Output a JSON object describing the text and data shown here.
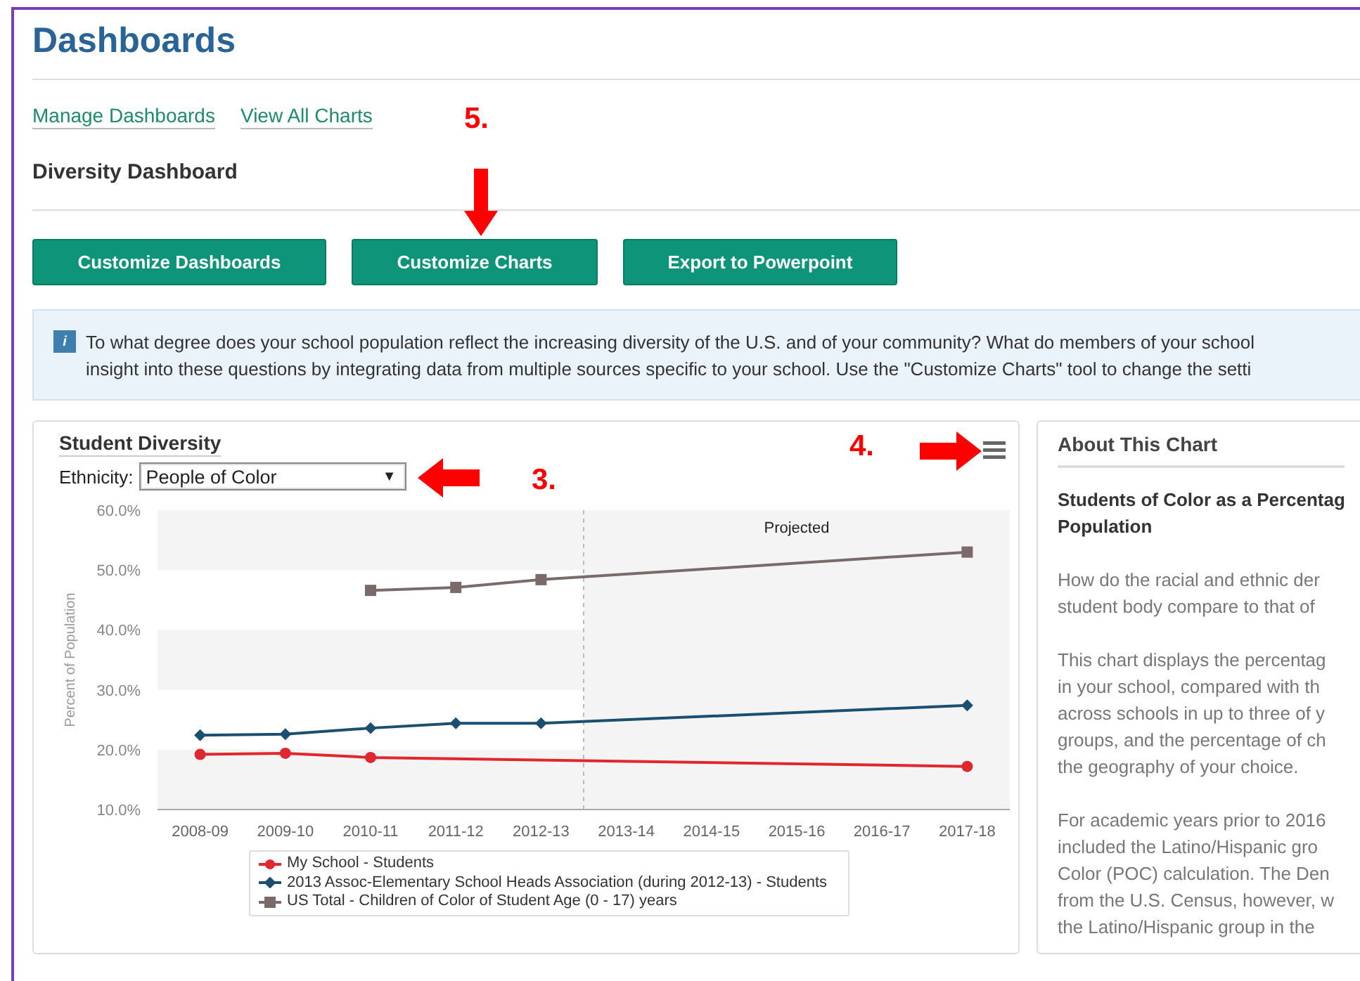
{
  "page_title": "Dashboards",
  "links": [
    "Manage Dashboards",
    "View All Charts"
  ],
  "dashboard_title": "Diversity Dashboard",
  "buttons": [
    "Customize Dashboards",
    "Customize Charts",
    "Export to Powerpoint"
  ],
  "info": {
    "icon": "i",
    "lines": [
      "To what degree does your school population reflect the increasing diversity of the U.S. and of your community? What do members of your school",
      "insight into these questions by integrating data from multiple sources specific to your school. Use the \"Customize Charts\" tool to change the setti"
    ]
  },
  "chart_card": {
    "title": "Student Diversity",
    "filter_label": "Ethnicity:",
    "filter_value": "People of Color",
    "filter_caret": "▼",
    "chart_data": {
      "type": "line",
      "ylabel": "Percent of Population",
      "categories": [
        "2008-09",
        "2009-10",
        "2010-11",
        "2011-12",
        "2012-13",
        "2013-14",
        "2014-15",
        "2015-16",
        "2016-17",
        "2017-18"
      ],
      "ylim": [
        10,
        60
      ],
      "yticks": [
        {
          "value": 10,
          "label": "10.0%"
        },
        {
          "value": 20,
          "label": "20.0%"
        },
        {
          "value": 30,
          "label": "30.0%"
        },
        {
          "value": 40,
          "label": "40.0%"
        },
        {
          "value": 50,
          "label": "50.0%"
        },
        {
          "value": 60,
          "label": "60.0%"
        }
      ],
      "annotations": [
        "Projected"
      ],
      "bands": [
        {
          "axis": "y",
          "from": 10,
          "to": 20
        },
        {
          "axis": "y",
          "from": 30,
          "to": 40
        },
        {
          "axis": "y",
          "from": 50,
          "to": 60
        },
        {
          "axis": "x",
          "from": "2013-14",
          "to": "2017-18"
        }
      ],
      "series": [
        {
          "name": "My School - Students",
          "color": "#e0262f",
          "marker": "circle",
          "values": [
            19.2,
            19.4,
            18.7,
            null,
            null,
            null,
            null,
            null,
            null,
            17.2
          ]
        },
        {
          "name": "2013 Assoc-Elementary School Heads Association (during 2012-13) - Students",
          "color": "#1b4f72",
          "marker": "diamond",
          "values": [
            22.4,
            22.6,
            23.6,
            24.4,
            24.4,
            null,
            null,
            null,
            null,
            27.4
          ]
        },
        {
          "name": "US Total - Children of Color of Student Age (0 - 17) years",
          "color": "#7a6a6a",
          "marker": "square",
          "values": [
            null,
            null,
            46.6,
            47.1,
            48.4,
            null,
            null,
            null,
            null,
            53.0
          ]
        }
      ]
    }
  },
  "about": {
    "title": "About This Chart",
    "subtitle_lines": [
      "Students of Color as a Percentag",
      "Population"
    ],
    "paragraphs": [
      [
        "How do the racial and ethnic der",
        "student body compare to that of"
      ],
      [
        "This chart displays the percentag",
        "in your school, compared with th",
        "across schools in up to three of y",
        "groups, and the percentage of ch",
        "the geography of your choice."
      ],
      [
        "For academic years prior to 2016",
        "included the Latino/Hispanic gro",
        "Color (POC) calculation. The Den",
        "from the U.S. Census, however, w",
        "the Latino/Hispanic group in the"
      ]
    ]
  },
  "annotations": [
    "5.",
    "3.",
    "4."
  ]
}
